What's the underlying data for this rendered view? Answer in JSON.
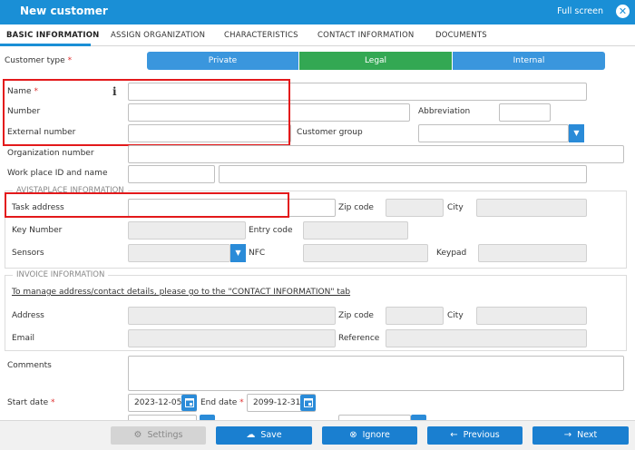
{
  "window": {
    "title": "New customer",
    "fullscreen_label": "Full screen",
    "close_glyph": "✕"
  },
  "tabs": [
    {
      "label": "BASIC INFORMATION",
      "active": true
    },
    {
      "label": "ASSIGN ORGANIZATION"
    },
    {
      "label": "CHARACTERISTICS"
    },
    {
      "label": "CONTACT INFORMATION"
    },
    {
      "label": "DOCUMENTS"
    }
  ],
  "customer_type": {
    "label": "Customer type",
    "required_mark": "*",
    "options": [
      "Private",
      "Legal",
      "Internal"
    ],
    "selected": "Legal",
    "colors": {
      "normal": "#3a96dd",
      "selected": "#33a853"
    }
  },
  "form": {
    "name_label": "Name",
    "name_required": "*",
    "info_icon": "i",
    "number_label": "Number",
    "abbreviation_label": "Abbreviation",
    "external_number_label": "External number",
    "customer_group_label": "Customer group",
    "organization_number_label": "Organization number",
    "workplace_label": "Work place ID and name",
    "comments_label": "Comments",
    "start_date_label": "Start date",
    "start_date_required": "*",
    "start_date_value": "2023-12-05",
    "end_date_label": "End date",
    "end_date_required": "*",
    "end_date_value": "2099-12-31"
  },
  "avistaplace": {
    "legend": "AVISTAPLACE INFORMATION",
    "task_address_label": "Task address",
    "zip_label": "Zip code",
    "city_label": "City",
    "key_number_label": "Key Number",
    "entry_code_label": "Entry code",
    "sensors_label": "Sensors",
    "nfc_label": "NFC",
    "keypad_label": "Keypad"
  },
  "invoice": {
    "legend": "INVOICE INFORMATION",
    "notice": "To manage address/contact details, please go to the \"CONTACT INFORMATION\" tab",
    "address_label": "Address",
    "zip_label": "Zip code",
    "city_label": "City",
    "email_label": "Email",
    "reference_label": "Reference"
  },
  "footer": {
    "settings": "Settings",
    "save": "Save",
    "ignore": "Ignore",
    "previous": "Previous",
    "next": "Next"
  },
  "colors": {
    "accent": "#1a8fd6",
    "highlight_box": "#e3191b"
  }
}
